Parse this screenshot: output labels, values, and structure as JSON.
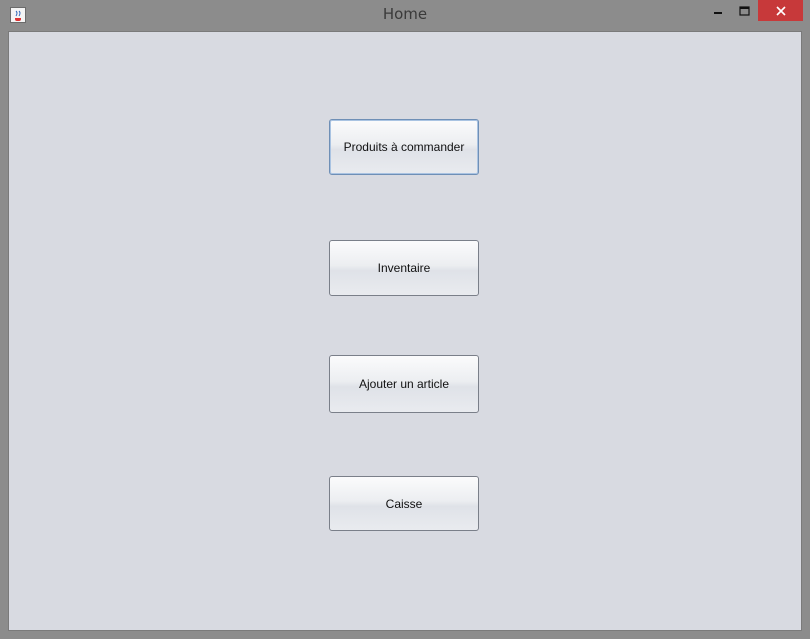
{
  "window": {
    "title": "Home",
    "icon": "java-cup-icon",
    "controls": [
      "minimize",
      "maximize",
      "close"
    ]
  },
  "buttons": [
    {
      "label": "Produits à commander"
    },
    {
      "label": "Inventaire"
    },
    {
      "label": "Ajouter un article"
    },
    {
      "label": "Caisse"
    }
  ],
  "colors": {
    "close": "#c7393a",
    "background": "#d8dae1"
  }
}
